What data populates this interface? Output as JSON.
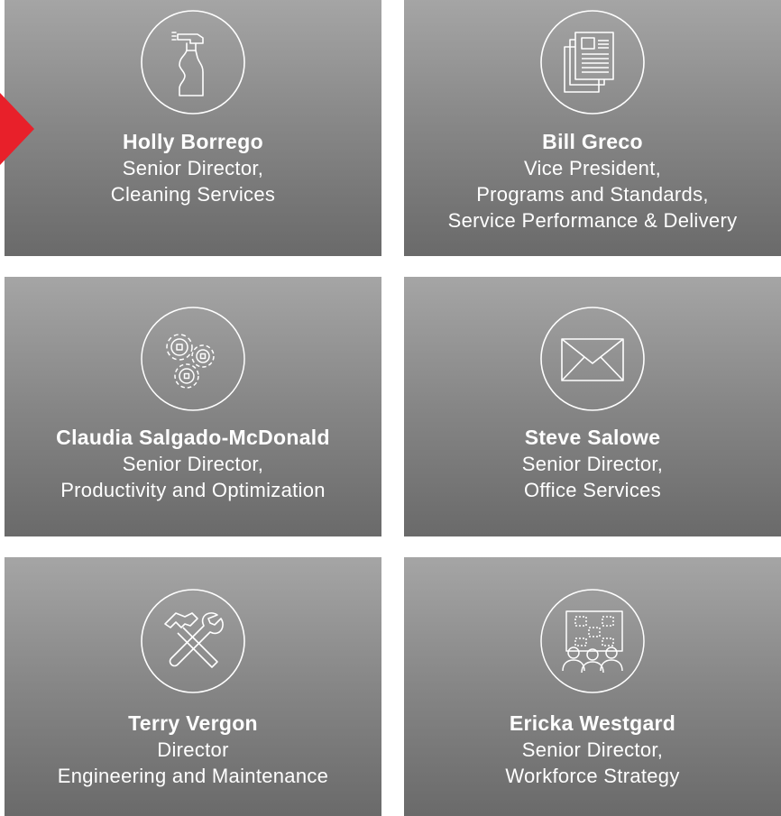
{
  "colors": {
    "accent": "#e8202a",
    "card_top": "#a5a5a5",
    "card_bottom": "#6a6a6a",
    "text": "#ffffff"
  },
  "cards": [
    {
      "icon": "spray-bottle-icon",
      "name": "Holly Borrego",
      "lines": [
        "Senior Director,",
        "Cleaning Services"
      ]
    },
    {
      "icon": "documents-icon",
      "name": "Bill Greco",
      "lines": [
        "Vice President,",
        "Programs and Standards,",
        "Service Performance & Delivery"
      ]
    },
    {
      "icon": "gears-icon",
      "name": "Claudia Salgado-McDonald",
      "lines": [
        "Senior Director,",
        "Productivity and Optimization"
      ]
    },
    {
      "icon": "envelope-icon",
      "name": "Steve Salowe",
      "lines": [
        "Senior Director,",
        "Office Services"
      ]
    },
    {
      "icon": "hammer-wrench-icon",
      "name": "Terry Vergon",
      "lines": [
        "Director",
        "Engineering and Maintenance"
      ]
    },
    {
      "icon": "people-whiteboard-icon",
      "name": "Ericka Westgard",
      "lines": [
        "Senior Director,",
        "Workforce Strategy"
      ]
    }
  ]
}
